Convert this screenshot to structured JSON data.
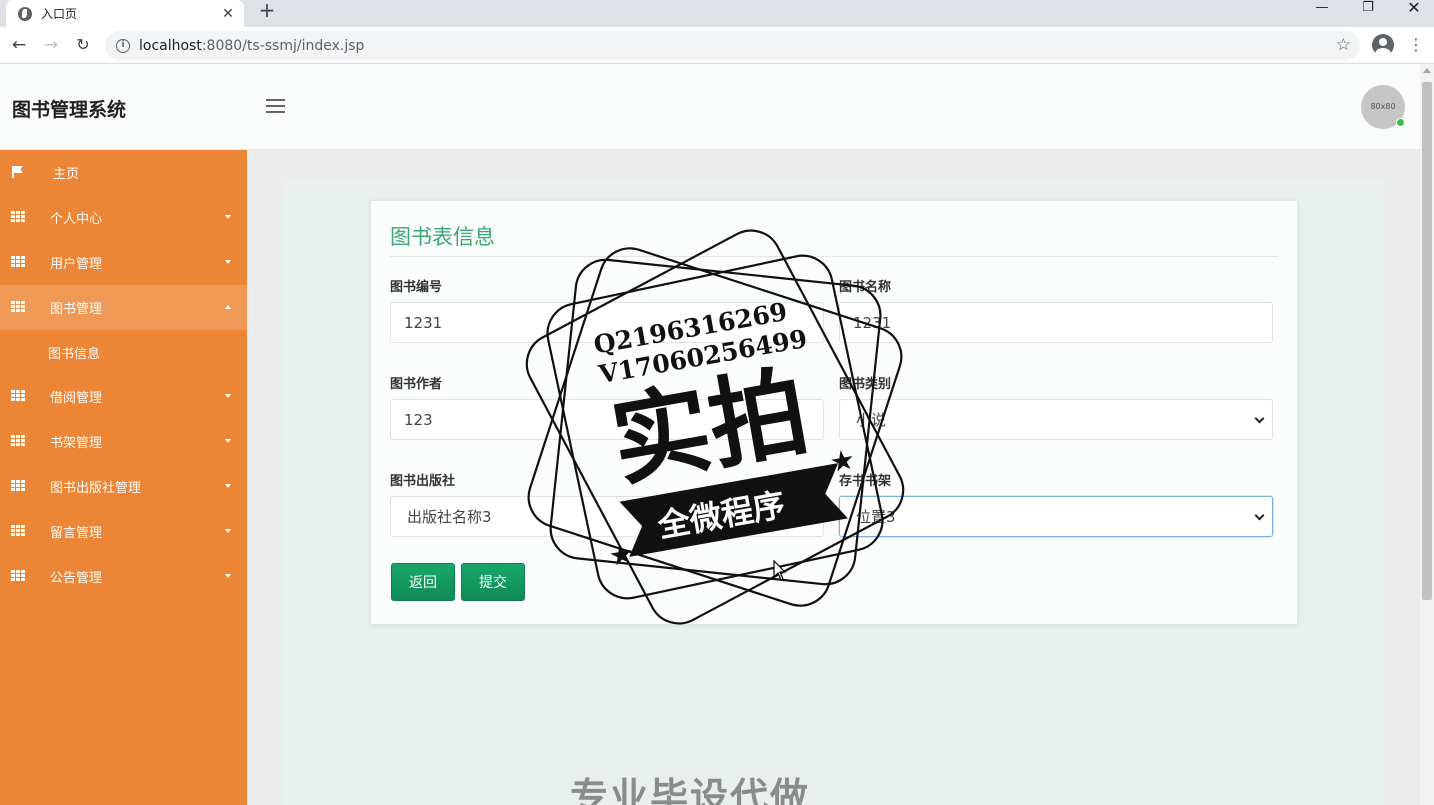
{
  "browser": {
    "tab_title": "入口页",
    "tab_close": "✕",
    "new_tab": "+",
    "url_host": "localhost",
    "url_path": ":8080/ts-ssmj/index.jsp",
    "window_controls": {
      "minimize": "—",
      "maximize": "❐",
      "close": "✕"
    }
  },
  "header": {
    "app_title": "图书管理系统",
    "avatar_text": "80x80"
  },
  "sidebar": {
    "items": [
      {
        "label": "主页",
        "icon": "flag-icon"
      },
      {
        "label": "个人中心",
        "icon": "grid-icon"
      },
      {
        "label": "用户管理",
        "icon": "grid-icon"
      },
      {
        "label": "图书管理",
        "icon": "grid-icon",
        "expanded": true
      },
      {
        "label": "图书信息",
        "icon": "none"
      },
      {
        "label": "借阅管理",
        "icon": "grid-icon"
      },
      {
        "label": "书架管理",
        "icon": "grid-icon"
      },
      {
        "label": "图书出版社管理",
        "icon": "grid-icon"
      },
      {
        "label": "留言管理",
        "icon": "grid-icon"
      },
      {
        "label": "公告管理",
        "icon": "grid-icon"
      }
    ]
  },
  "form": {
    "title": "图书表信息",
    "fields": {
      "book_no": {
        "label": "图书编号",
        "value": "1231"
      },
      "book_name": {
        "label": "图书名称",
        "value": "1231"
      },
      "author": {
        "label": "图书作者",
        "value": "123"
      },
      "category": {
        "label": "图书类别",
        "value": "小说"
      },
      "publisher": {
        "label": "图书出版社",
        "value": "出版社名称3"
      },
      "shelf": {
        "label": "存书书架",
        "value": "位置3"
      }
    },
    "buttons": {
      "back": "返回",
      "submit": "提交"
    }
  },
  "watermark": {
    "line1": "Q2196316269",
    "line2": "V17060256499",
    "big": "实拍",
    "banner": "全微程序",
    "bottom": "专业毕设代做"
  },
  "colors": {
    "sidebar": "#ec8535",
    "accent_green": "#38a874",
    "button_green": "#139860"
  }
}
